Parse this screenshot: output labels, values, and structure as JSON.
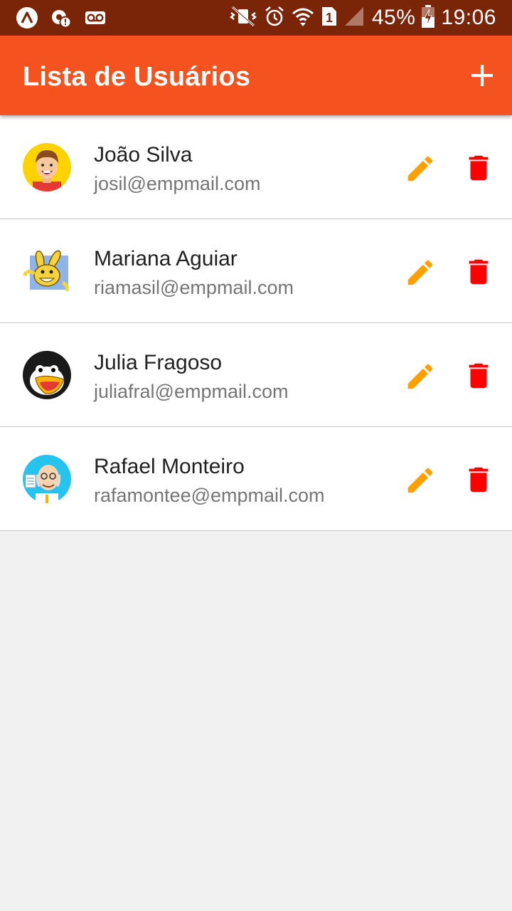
{
  "status_bar": {
    "battery_percent": "45%",
    "time": "19:06",
    "sim_slot": "1",
    "icons": [
      "app-notification-icon",
      "alert-notification-icon",
      "voicemail-icon",
      "mute-vibrate-icon",
      "alarm-icon",
      "wifi-icon",
      "sim-icon",
      "signal-icon",
      "battery-charging-icon"
    ]
  },
  "app_bar": {
    "title": "Lista de Usuários",
    "add_icon": "plus-icon"
  },
  "users": [
    {
      "name": "João Silva",
      "email": "josil@empmail.com",
      "avatar": "boy-cartoon-avatar"
    },
    {
      "name": "Mariana Aguiar",
      "email": "riamasil@empmail.com",
      "avatar": "rabbit-cartoon-avatar"
    },
    {
      "name": "Julia Fragoso",
      "email": "juliafral@empmail.com",
      "avatar": "penguin-cartoon-avatar"
    },
    {
      "name": "Rafael Monteiro",
      "email": "rafamontee@empmail.com",
      "avatar": "old-man-cartoon-avatar"
    }
  ],
  "colors": {
    "status_bar": "#7a2508",
    "app_bar": "#f4521e",
    "edit_icon": "#ffa000",
    "delete_icon": "#ff0000",
    "background": "#f1f1f1"
  }
}
